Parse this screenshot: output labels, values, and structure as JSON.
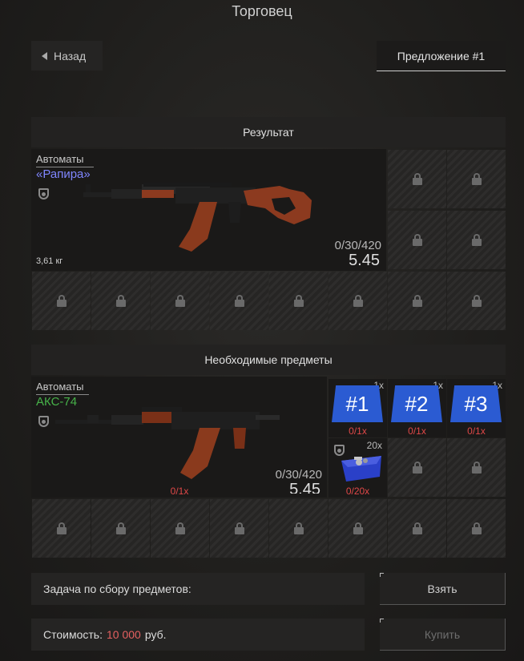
{
  "window": {
    "title": "Торговец"
  },
  "header": {
    "back_label": "Назад",
    "offer_tab_label": "Предложение #1"
  },
  "result": {
    "section_title": "Результат",
    "item": {
      "category": "Автоматы",
      "name": "«Рапира»",
      "ammo": "0/30/420",
      "caliber": "5.45",
      "weight": "3,61 кг",
      "name_color": "#7f86ff"
    }
  },
  "required": {
    "section_title": "Необходимые предметы",
    "item": {
      "category": "Автоматы",
      "name": "АКС-74",
      "ammo": "0/30/420",
      "caliber": "5.45",
      "requirement": "0/1x",
      "name_color": "#47b249"
    },
    "blueprints": [
      {
        "label": "#1",
        "count": "1x",
        "requirement": "0/1x"
      },
      {
        "label": "#2",
        "count": "1x",
        "requirement": "0/1x"
      },
      {
        "label": "#3",
        "count": "1x",
        "requirement": "0/1x"
      }
    ],
    "parts": {
      "count": "20x",
      "requirement": "0/20x"
    }
  },
  "task": {
    "label": "Задача по сбору предметов:",
    "take_button": "Взять"
  },
  "cost": {
    "label": "Стоимость:",
    "value": "10 000",
    "currency": "руб.",
    "buy_button": "Купить",
    "price_color": "#e46060"
  }
}
